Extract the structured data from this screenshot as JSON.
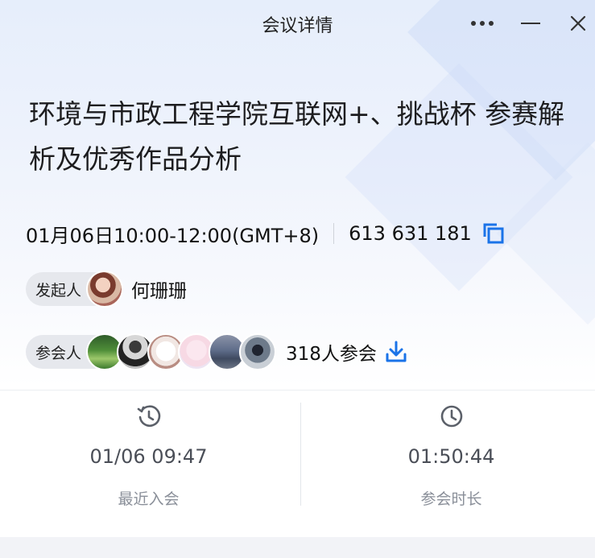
{
  "window": {
    "title": "会议详情"
  },
  "meeting": {
    "title": "环境与市政工程学院互联网+、挑战杯 参赛解析及优秀作品分析",
    "time": "01月06日10:00-12:00(GMT+8)",
    "meeting_id": "613 631 181"
  },
  "host": {
    "label": "发起人",
    "name": "何珊珊"
  },
  "participants": {
    "label": "参会人",
    "count_text": "318人参会"
  },
  "stats": [
    {
      "value": "01/06 09:47",
      "label": "最近入会",
      "icon": "history-icon"
    },
    {
      "value": "01:50:44",
      "label": "参会时长",
      "icon": "clock-icon"
    }
  ],
  "colors": {
    "accent": "#1a73e8",
    "icon_gray": "#5b6069"
  }
}
